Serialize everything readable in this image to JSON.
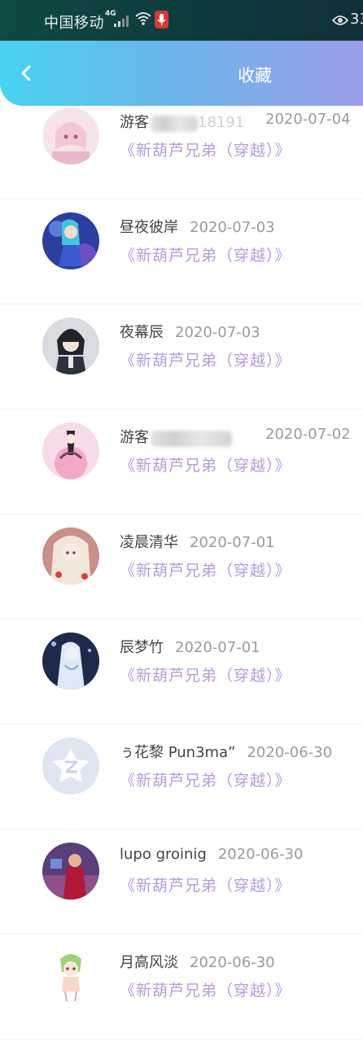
{
  "status_bar": {
    "carrier": "中国移动",
    "network": "4G",
    "battery_text": "33"
  },
  "header": {
    "title": "收藏",
    "back_icon": "chevron-left-icon"
  },
  "entries": [
    {
      "name": "游客",
      "name_tail": "18191",
      "date": "2020-07-04",
      "book": "《新葫芦兄弟（穿越）》"
    },
    {
      "name": "昼夜彼岸",
      "date": "2020-07-03",
      "book": "《新葫芦兄弟（穿越）》"
    },
    {
      "name": "夜幕辰",
      "date": "2020-07-03",
      "book": "《新葫芦兄弟（穿越）》"
    },
    {
      "name": "游客",
      "date": "2020-07-02",
      "book": "《新葫芦兄弟（穿越）》"
    },
    {
      "name": "凌晨清华",
      "date": "2020-07-01",
      "book": "《新葫芦兄弟（穿越）》"
    },
    {
      "name": "辰梦竹",
      "date": "2020-07-01",
      "book": "《新葫芦兄弟（穿越）》"
    },
    {
      "name": "ぅ花黎 Pun3ma”",
      "date": "2020-06-30",
      "book": "《新葫芦兄弟（穿越）》"
    },
    {
      "name": "lupo groinig",
      "date": "2020-06-30",
      "book": "《新葫芦兄弟（穿越）》"
    },
    {
      "name": "月高风淡",
      "date": "2020-06-30",
      "book": "《新葫芦兄弟（穿越）》"
    }
  ],
  "colors": {
    "header_gradient_start": "#48d2f0",
    "header_gradient_end": "#9b9ee8",
    "book_title": "#b99bd8",
    "date_text": "#9a9a9a"
  }
}
